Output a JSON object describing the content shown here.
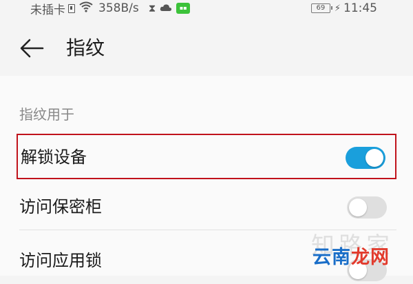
{
  "status_bar": {
    "carrier": "未插卡",
    "network_speed": "358B/s",
    "battery_level": "69",
    "time": "11:45",
    "icons": [
      "sim-icon",
      "wifi-icon",
      "hourglass-icon",
      "cloud-icon",
      "app-badge-icon",
      "battery-icon",
      "charging-icon"
    ]
  },
  "header": {
    "title": "指纹",
    "back_icon": "back-arrow-icon"
  },
  "section": {
    "label": "指纹用于",
    "items": [
      {
        "label": "解锁设备",
        "enabled": true,
        "highlighted": true
      },
      {
        "label": "访问保密柜",
        "enabled": false,
        "highlighted": false
      },
      {
        "label": "访问应用锁",
        "enabled": false,
        "highlighted": false
      }
    ]
  },
  "watermarks": {
    "top": "知路家",
    "bottom_part1": "云南",
    "bottom_part2": "龙网"
  },
  "colors": {
    "toggle_on": "#1a9fdc",
    "toggle_off": "#dfdfdf",
    "highlight_border": "#c0121b"
  }
}
